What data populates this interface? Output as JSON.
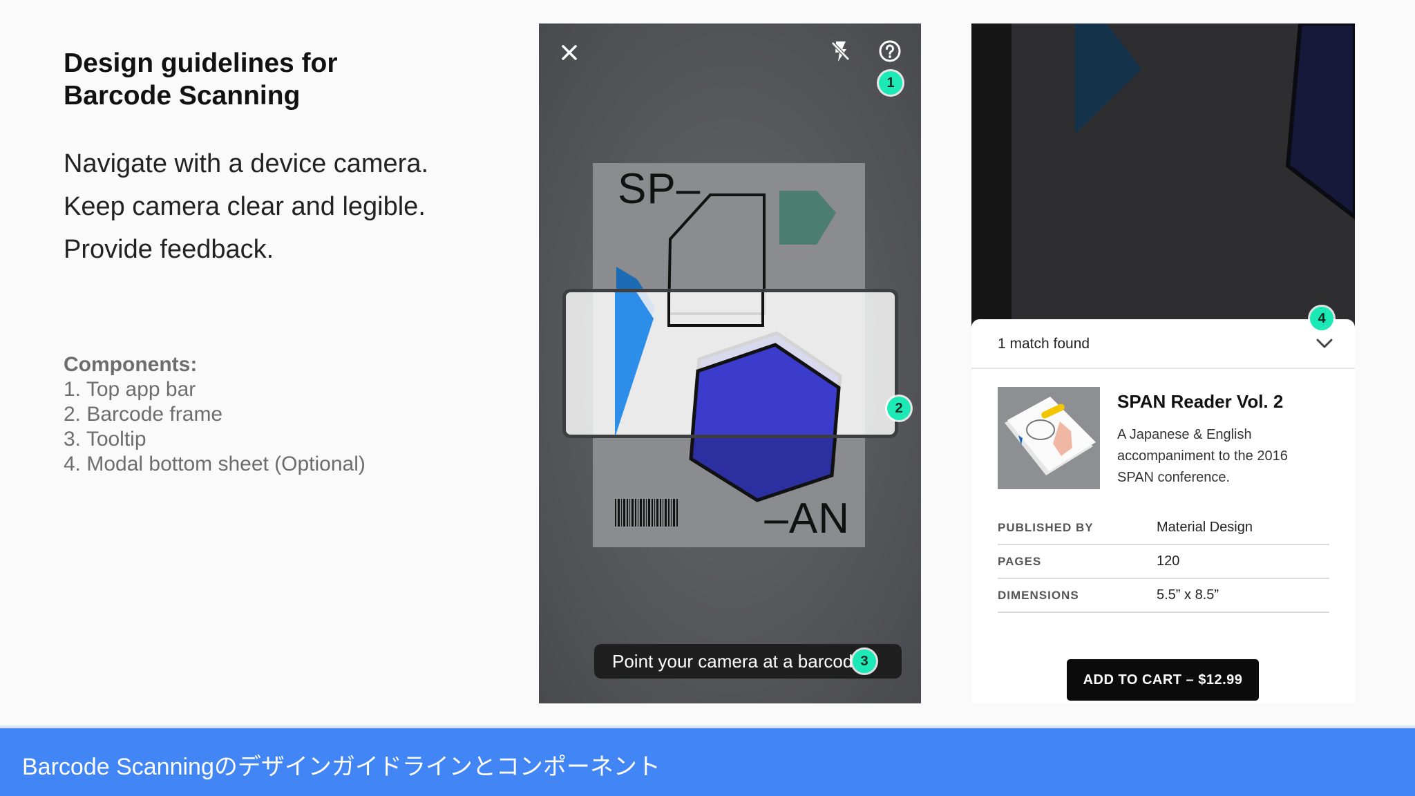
{
  "slide": {
    "title_line1": "Design guidelines for",
    "title_line2": "Barcode Scanning",
    "guidelines": [
      "Navigate with a device camera.",
      "Keep camera clear and legible.",
      "Provide feedback."
    ],
    "components_heading": "Components:",
    "components": [
      "1. Top app bar",
      "2. Barcode frame",
      "3. Tooltip",
      "4. Modal bottom sheet (Optional)"
    ]
  },
  "scanner": {
    "icons": {
      "close": "close-icon",
      "flash": "flash-off-icon",
      "help": "help-icon"
    },
    "book_text_top": "SP–",
    "book_text_bottom": "–AN",
    "tooltip": "Point your camera at a barcode",
    "badges": {
      "top_app_bar": "1",
      "barcode_frame": "2",
      "tooltip": "3"
    }
  },
  "result": {
    "badge": "4",
    "match_text": "1 match found",
    "product_title": "SPAN Reader Vol. 2",
    "product_description": "A Japanese & English accompaniment to the 2016 SPAN conference.",
    "details": [
      {
        "label": "PUBLISHED BY",
        "value": "Material Design"
      },
      {
        "label": "PAGES",
        "value": "120"
      },
      {
        "label": "DIMENSIONS",
        "value": "5.5” x 8.5”"
      }
    ],
    "cart_button": "ADD TO CART – $12.99"
  },
  "banner": {
    "text": "Barcode Scanningのデザインガイドラインとコンポーネント"
  },
  "colors": {
    "accent_badge": "#1de9b6",
    "banner": "#4285f4",
    "cart_button": "#0b0b0b"
  }
}
